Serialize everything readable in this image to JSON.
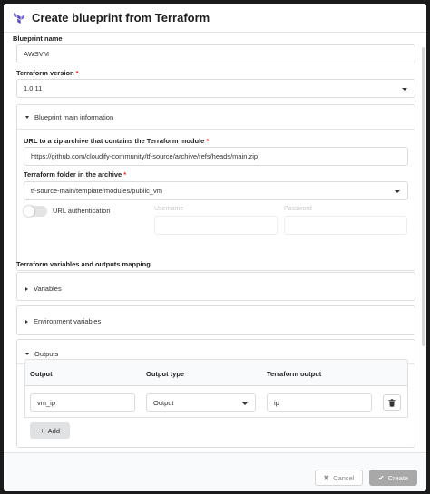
{
  "modal": {
    "title": "Create blueprint from Terraform"
  },
  "form": {
    "blueprint_name": {
      "label": "Blueprint name",
      "value": "AWSVM"
    },
    "terraform_version": {
      "label": "Terraform version",
      "value": "1.0.11",
      "required": "*"
    },
    "main_info": {
      "title": "Blueprint main information",
      "url_label": "URL to a zip archive that contains the Terraform module",
      "url_required": "*",
      "url_value": "https://github.com/cloudify-community/tf-source/archive/refs/heads/main.zip",
      "folder_label": "Terraform folder in the archive",
      "folder_required": "*",
      "folder_value": "tf-source-main/template/modules/public_vm",
      "url_auth_label": "URL authentication",
      "username_label": "Username",
      "password_label": "Password"
    },
    "mapping": {
      "title": "Terraform variables and outputs mapping",
      "variables_title": "Variables",
      "env_title": "Environment variables",
      "outputs_title": "Outputs",
      "columns": [
        "Output",
        "Output type",
        "Terraform output"
      ],
      "rows": [
        {
          "output": "vm_ip",
          "type": "Output",
          "terraform_output": "ip"
        }
      ],
      "add_label": "Add"
    }
  },
  "footer": {
    "cancel_label": "Cancel",
    "create_label": "Create"
  },
  "colors": {
    "accent": "#5b4eb0",
    "required": "#db2828",
    "create_button": "#a8a8a8"
  },
  "icons": {
    "logo": "terraform-logo-icon",
    "delete": "trash-icon",
    "add": "plus-icon",
    "cancel": "close-icon",
    "create": "check-icon"
  }
}
